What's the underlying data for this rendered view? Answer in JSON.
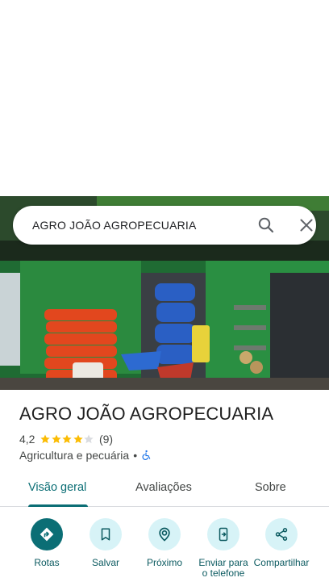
{
  "search": {
    "query": "AGRO JOÃO AGROPECUARIA"
  },
  "place": {
    "name": "AGRO JOÃO AGROPECUARIA",
    "rating": "4,2",
    "rating_value": 4.2,
    "stars_total": 5,
    "review_count": "(9)",
    "category": "Agricultura e pecuária",
    "separator": "•"
  },
  "tabs": [
    {
      "label": "Visão geral",
      "active": true
    },
    {
      "label": "Avaliações",
      "active": false
    },
    {
      "label": "Sobre",
      "active": false
    }
  ],
  "actions": [
    {
      "label": "Rotas",
      "icon": "directions-icon"
    },
    {
      "label": "Salvar",
      "icon": "bookmark-icon"
    },
    {
      "label": "Próximo",
      "icon": "nearby-icon"
    },
    {
      "label": "Enviar para o telefone",
      "icon": "send-to-phone-icon"
    },
    {
      "label": "Compartilhar",
      "icon": "share-icon"
    }
  ],
  "colors": {
    "accent": "#0b6e75",
    "action_bg": "#d7f3f7",
    "star": "#fbbc04",
    "star_empty": "#dadce0",
    "accessibility": "#1a73e8"
  }
}
